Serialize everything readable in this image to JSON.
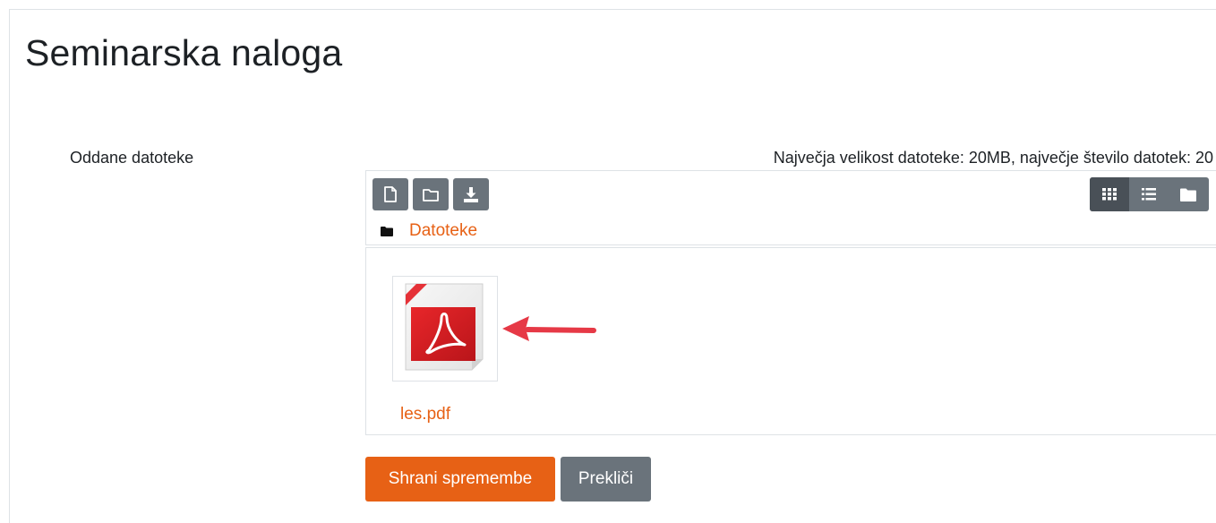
{
  "page": {
    "title": "Seminarska naloga"
  },
  "form": {
    "field_label": "Oddane datoteke",
    "limits_text": "Največja velikost datoteke: 20MB, največje število datotek: 20"
  },
  "filepicker": {
    "toolbar": {
      "buttons": [
        {
          "icon": "file-icon"
        },
        {
          "icon": "folder-outline-icon"
        },
        {
          "icon": "download-icon"
        }
      ],
      "view_modes": [
        {
          "icon": "grid-view-icon",
          "active": true
        },
        {
          "icon": "list-view-icon",
          "active": false
        },
        {
          "icon": "folder-tree-view-icon",
          "active": false
        }
      ]
    },
    "path": {
      "icon": "folder-icon",
      "label": "Datoteke"
    },
    "files": [
      {
        "name": "les.pdf",
        "icon": "pdf-file-icon"
      }
    ]
  },
  "actions": {
    "save_label": "Shrani spremembe",
    "cancel_label": "Prekliči"
  },
  "colors": {
    "accent": "#e76115",
    "secondary": "#6a737b",
    "arrow": "#e63946",
    "text": "#1d2125",
    "border": "#dee2e6"
  }
}
